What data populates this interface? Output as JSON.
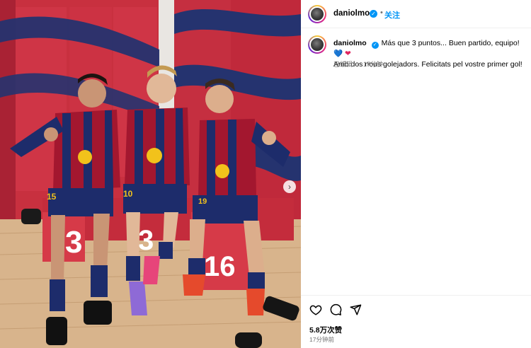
{
  "post": {
    "username": "daniolmo",
    "verified_mark": "✓",
    "dot": "•",
    "follow_label": "关注"
  },
  "caption": {
    "username": "daniolmo",
    "text": "Más que 3 puntos... Buen partido, equipo!",
    "emoji_1": "💙",
    "emoji_2": "❤",
    "text_2": "Amb dos nous golejadors. Felicitats pel vostre primer gol!",
    "edited": "已编辑",
    "dot": "·",
    "time": "17分钟"
  },
  "actions": {
    "likes": "5.8万次赞",
    "time_ago": "17分钟前"
  },
  "photo": {
    "seat_numbers": [
      "3",
      "3",
      "16"
    ],
    "shirt_numbers": [
      "15",
      "10",
      "19"
    ],
    "carousel_next": "›"
  },
  "icons": [
    "heart-icon",
    "comment-icon",
    "share-icon",
    "chevron-right-icon",
    "verified-icon"
  ],
  "colors": {
    "accent": "#0095f6",
    "kit_blue": "#1d2c6b",
    "kit_red": "#a3172f",
    "locker_red": "#c8303f"
  }
}
